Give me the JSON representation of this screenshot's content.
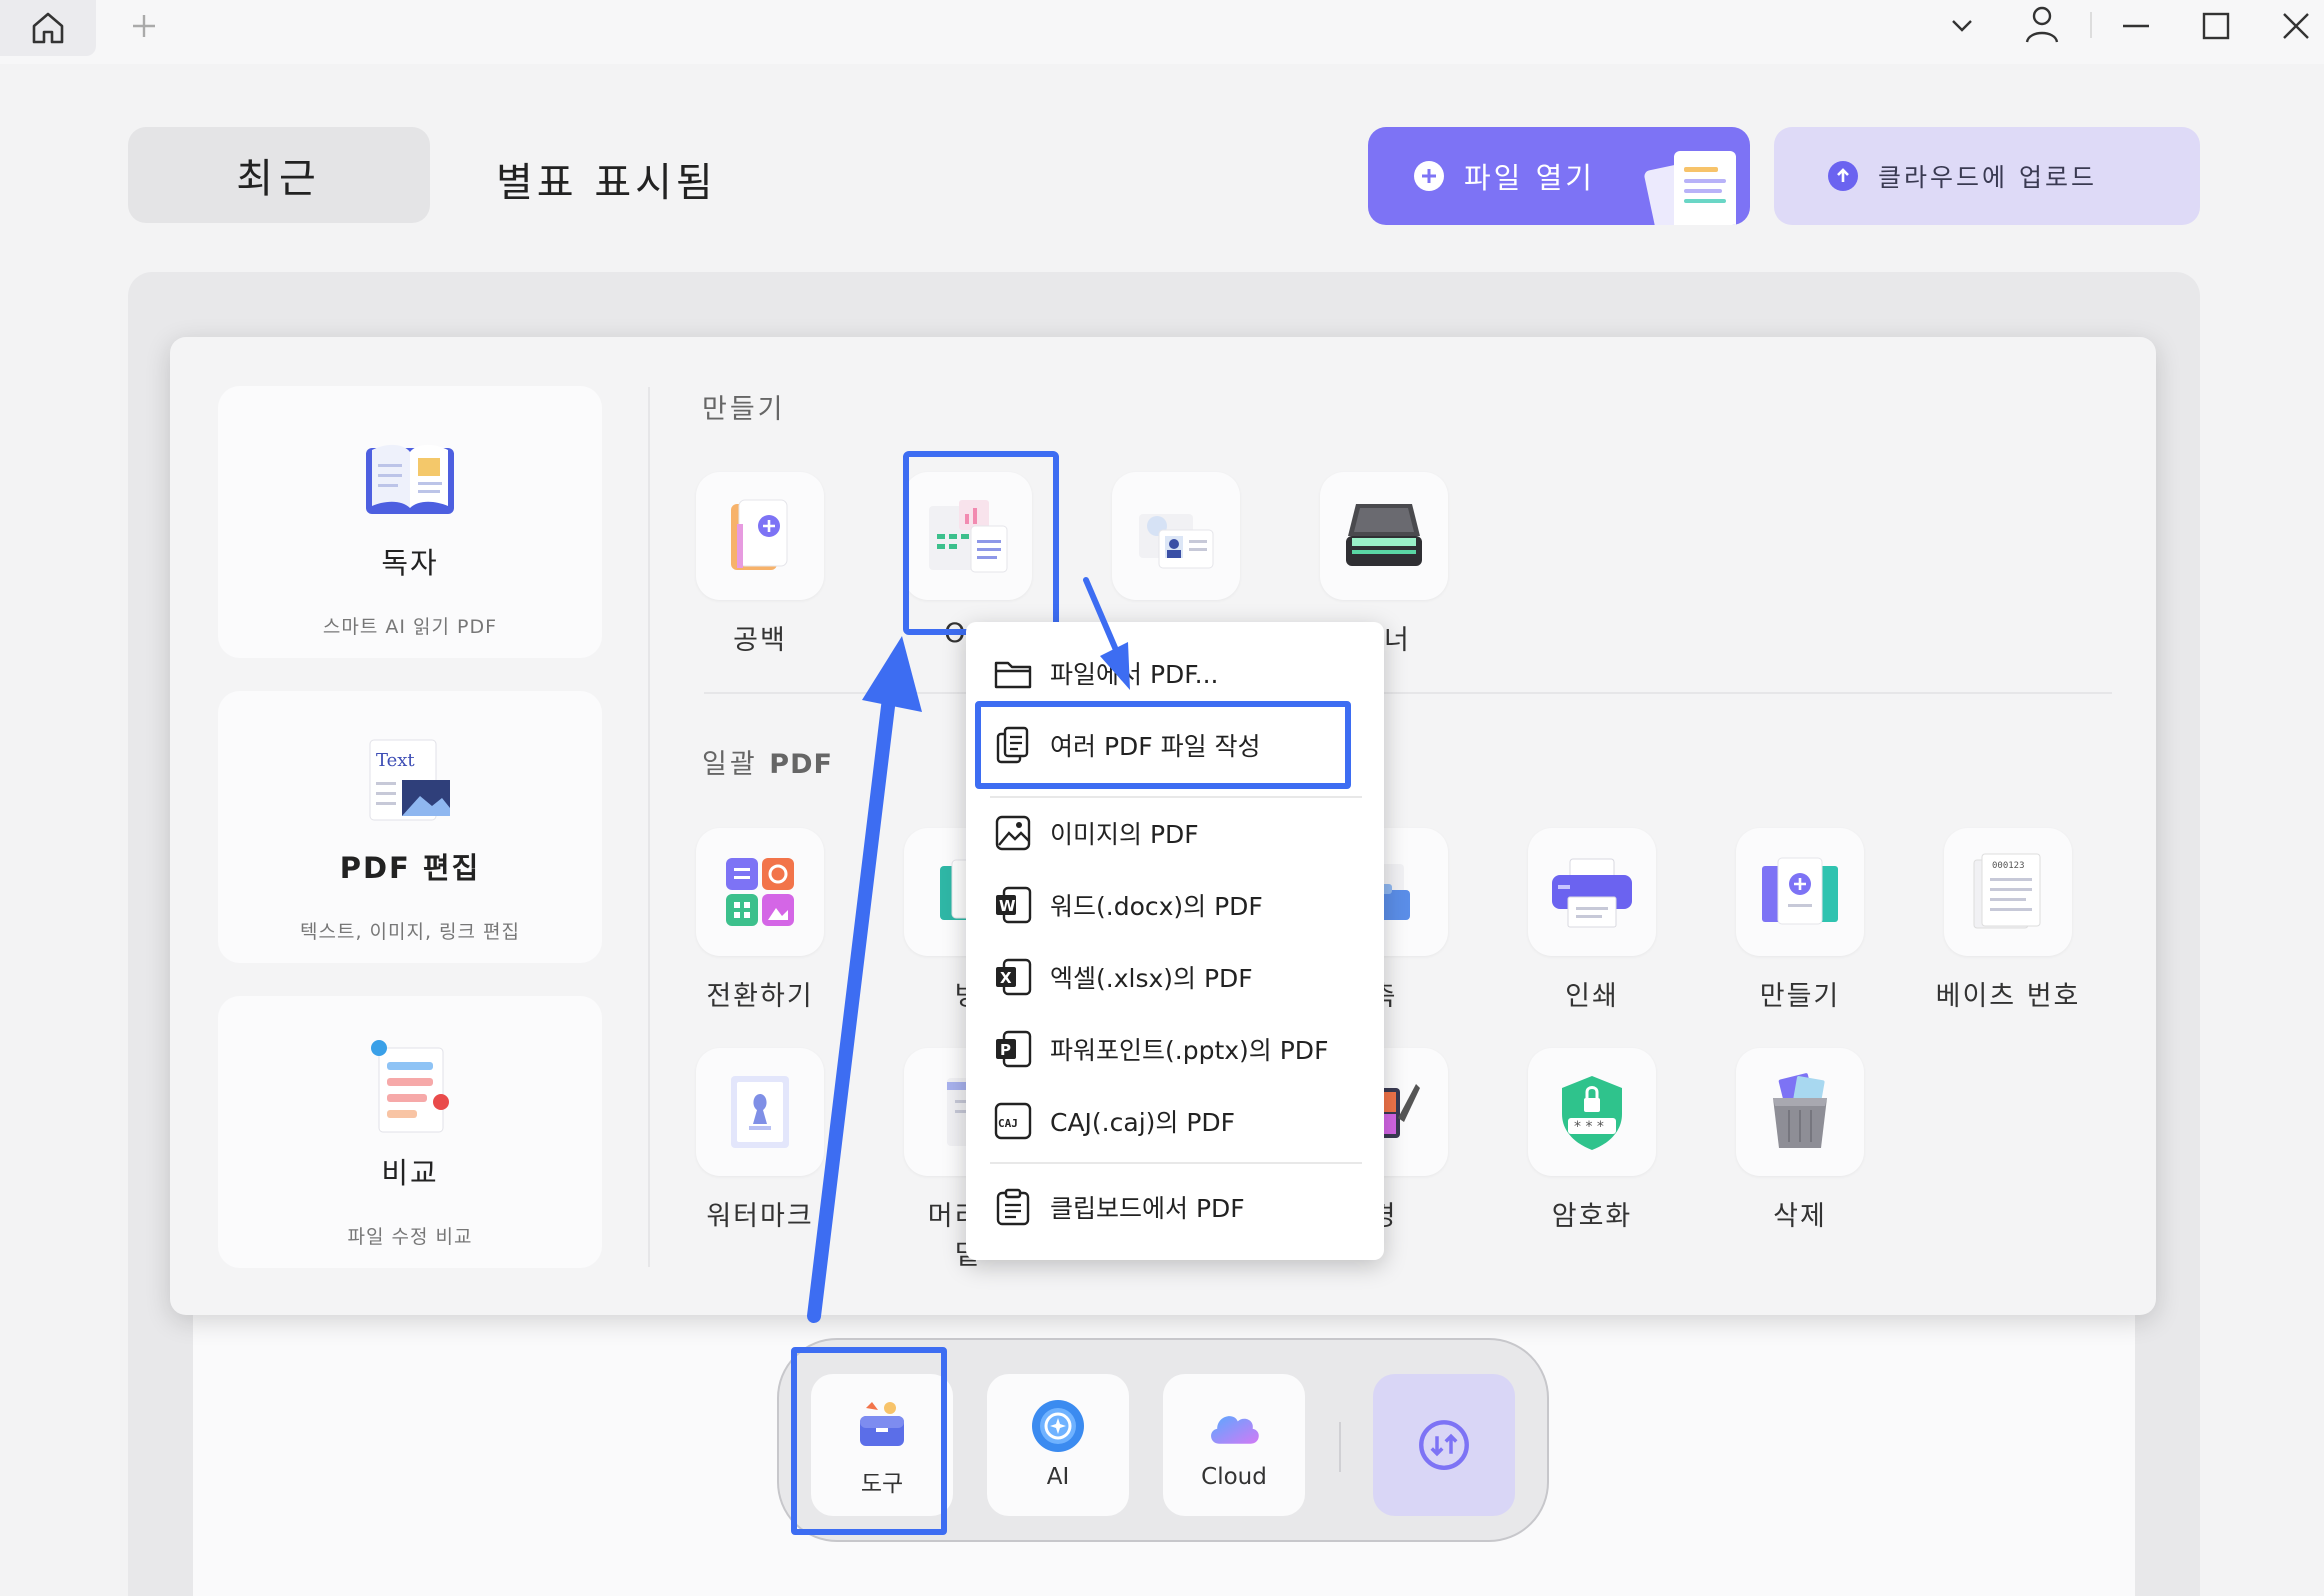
{
  "header": {
    "tab_recent": "최근",
    "tab_starred": "별표 표시됨",
    "open_file": "파일 열기",
    "upload_cloud": "클라우드에 업로드"
  },
  "sidebar": [
    {
      "title": "독자",
      "subtitle": "스마트 AI 읽기 PDF"
    },
    {
      "title": "PDF 편집",
      "subtitle": "텍스트, 이미지, 링크 편집",
      "icon_text": "Text"
    },
    {
      "title": "비교",
      "subtitle": "파일 수정 비교"
    }
  ],
  "create": {
    "title": "만들기",
    "items": [
      {
        "label": "공백",
        "icon": "blank-page-icon"
      },
      {
        "label": "O+",
        "icon": "from-file-icon"
      },
      {
        "label": "",
        "icon": "id-card-icon"
      },
      {
        "label": "캐너",
        "icon": "scanner-icon"
      }
    ]
  },
  "batch": {
    "title_ko": "일괄",
    "title_pdf": "PDF",
    "row1": [
      {
        "label": "전환하기",
        "icon": "convert-icon"
      },
      {
        "label": "병",
        "icon": "merge-icon"
      },
      {
        "label": "축",
        "icon": "compress-icon"
      },
      {
        "label": "인쇄",
        "icon": "print-icon"
      },
      {
        "label": "만들기",
        "icon": "create-icon"
      },
      {
        "label": "베이츠 번호",
        "icon": "bates-number-icon"
      }
    ],
    "row2": [
      {
        "label": "워터마크",
        "icon": "watermark-icon"
      },
      {
        "label": "머리말",
        "label2": "밑",
        "icon": "header-footer-icon"
      },
      {
        "label": "경",
        "icon": "background-icon"
      },
      {
        "label": "암호화",
        "icon": "encrypt-icon"
      },
      {
        "label": "삭제",
        "icon": "trash-icon"
      }
    ]
  },
  "dropdown": [
    {
      "label": "파일에서 PDF...",
      "icon": "folder-icon"
    },
    {
      "label": "여러 PDF 파일 작성",
      "icon": "multi-file-icon"
    },
    {
      "label": "이미지의 PDF",
      "icon": "image-icon"
    },
    {
      "label": "워드(.docx)의 PDF",
      "icon": "word-icon",
      "glyph": "W"
    },
    {
      "label": "엑셀(.xlsx)의 PDF",
      "icon": "excel-icon",
      "glyph": "X"
    },
    {
      "label": "파워포인트(.pptx)의 PDF",
      "icon": "powerpoint-icon",
      "glyph": "P"
    },
    {
      "label": "CAJ(.caj)의 PDF",
      "icon": "caj-icon",
      "glyph": "CAJ"
    },
    {
      "label": "클립보드에서 PDF",
      "icon": "clipboard-icon"
    }
  ],
  "dock": [
    {
      "label": "도구",
      "icon": "toolbox-icon"
    },
    {
      "label": "AI",
      "icon": "ai-icon"
    },
    {
      "label": "Cloud",
      "icon": "cloud-icon"
    }
  ],
  "colors": {
    "accent": "#7d73f5",
    "highlight": "#3d6df2"
  }
}
